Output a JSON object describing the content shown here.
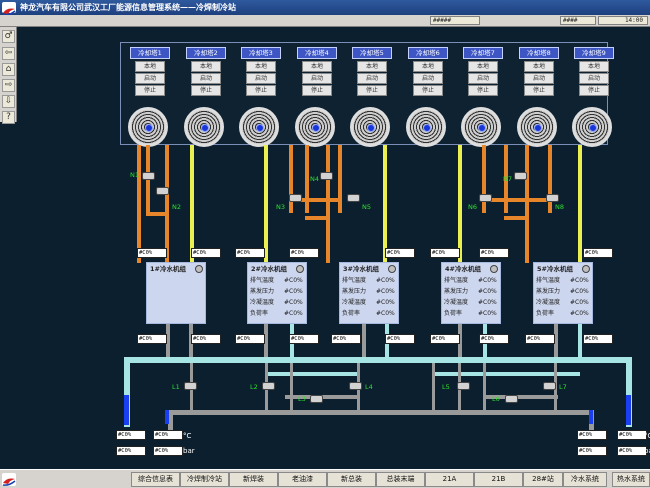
{
  "app": {
    "title": "神龙汽车有限公司武汉工厂能源信息管理系统——冷焊制冷站",
    "menu_boxes": [
      "#####",
      "####",
      "14:00"
    ]
  },
  "toolbar": {
    "icons": [
      "pin-icon",
      "left-arrow-icon",
      "home-icon",
      "right-arrow-icon",
      "down-arrow-icon",
      "help-icon"
    ],
    "glyphs": [
      "♂",
      "⇦",
      "⌂",
      "⇨",
      "⇩",
      "?"
    ]
  },
  "towers": [
    {
      "label": "冷却塔1",
      "buttons": [
        "本地",
        "启动",
        "停止"
      ]
    },
    {
      "label": "冷却塔2",
      "buttons": [
        "本地",
        "启动",
        "停止"
      ]
    },
    {
      "label": "冷却塔3",
      "buttons": [
        "本地",
        "启动",
        "停止"
      ]
    },
    {
      "label": "冷却塔4",
      "buttons": [
        "本地",
        "启动",
        "停止"
      ]
    },
    {
      "label": "冷却塔5",
      "buttons": [
        "本地",
        "启动",
        "停止"
      ]
    },
    {
      "label": "冷却塔6",
      "buttons": [
        "本地",
        "启动",
        "停止"
      ]
    },
    {
      "label": "冷却塔7",
      "buttons": [
        "本地",
        "启动",
        "停止"
      ]
    },
    {
      "label": "冷却塔8",
      "buttons": [
        "本地",
        "启动",
        "停止"
      ]
    },
    {
      "label": "冷却塔9",
      "buttons": [
        "本地",
        "启动",
        "停止"
      ]
    }
  ],
  "valves": {
    "top": [
      "N1",
      "N2",
      "N3",
      "N4",
      "N5",
      "N6",
      "N7",
      "N8"
    ],
    "bottom": [
      "L1",
      "L2",
      "L3",
      "L4",
      "L5",
      "L6",
      "L7"
    ]
  },
  "chillers": [
    {
      "title": "1#冷水机组"
    },
    {
      "title": "2#冷水机组",
      "rows": [
        [
          "排气温度",
          "#C0%"
        ],
        [
          "蒸发压力",
          "#C0%"
        ],
        [
          "冷凝温度",
          "#C0%"
        ],
        [
          "负荷率",
          "#C0%"
        ]
      ]
    },
    {
      "title": "3#冷水机组",
      "rows": [
        [
          "排气温度",
          "#C0%"
        ],
        [
          "蒸发压力",
          "#C0%"
        ],
        [
          "冷凝温度",
          "#C0%"
        ],
        [
          "负荷率",
          "#C0%"
        ]
      ]
    },
    {
      "title": "4#冷水机组",
      "rows": [
        [
          "排气温度",
          "#C0%"
        ],
        [
          "蒸发压力",
          "#C0%"
        ],
        [
          "冷凝温度",
          "#C0%"
        ],
        [
          "负荷率",
          "#C0%"
        ]
      ]
    },
    {
      "title": "5#冷水机组",
      "rows": [
        [
          "排气温度",
          "#C0%"
        ],
        [
          "蒸发压力",
          "#C0%"
        ],
        [
          "冷凝温度",
          "#C0%"
        ],
        [
          "负荷率",
          "#C0%"
        ]
      ]
    }
  ],
  "readout": "#C0%",
  "units": {
    "temp": "°C",
    "pressure": "bar"
  },
  "nav": [
    "综合信息表",
    "冷焊制冷站",
    "新焊装",
    "老油漆",
    "新总装",
    "总装末端",
    "21A",
    "21B",
    "28#站",
    "冷水系统",
    "热水系统"
  ],
  "colors": {
    "bg": "#0b1f2e",
    "orange_pipe": "#e6852a",
    "yellow_pipe": "#ecef50",
    "cyan_pipe": "#a7e4e4",
    "gray_pipe": "#9a9a9a",
    "tower_label": "#3d56c4"
  }
}
